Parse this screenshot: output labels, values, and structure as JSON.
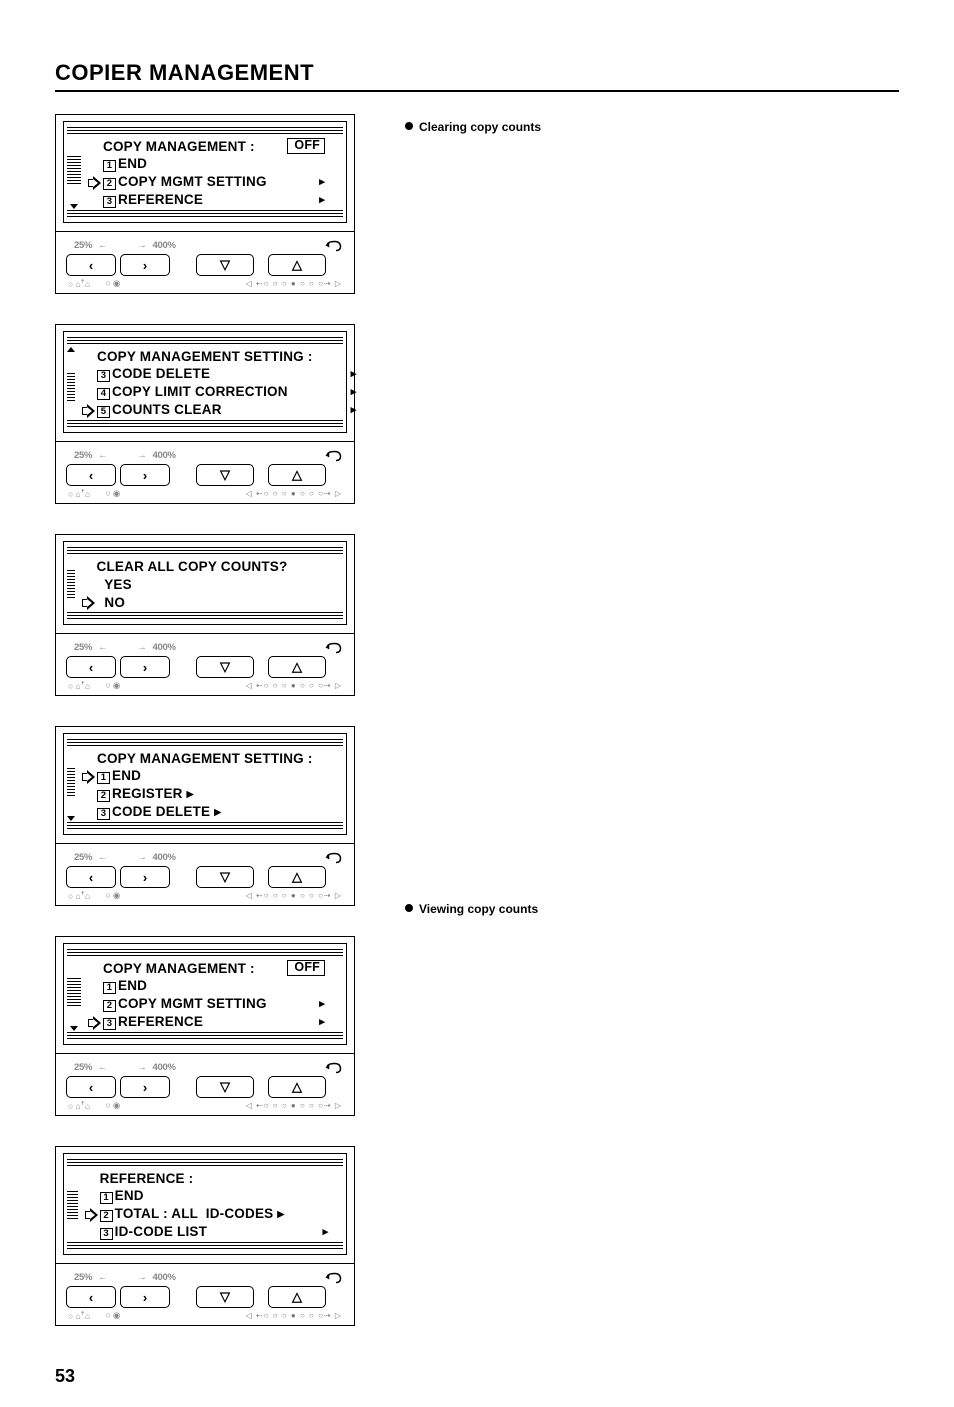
{
  "page": {
    "title": "COPIER MANAGEMENT",
    "number": "53"
  },
  "notes": {
    "clearing": "Clearing copy counts",
    "viewing": "Viewing copy counts"
  },
  "controls": {
    "zoom_left": "25%",
    "zoom_right": "400%",
    "btn_left": "‹",
    "btn_right": "›",
    "btn_down": "▽",
    "btn_up": "△",
    "foot_left": "○ ⌂ꜛ⌂",
    "foot_mid": "○ ◉",
    "foot_dots": "◁ ⇠○  ○  ○  ●  ○  ○  ○⇢ ▷"
  },
  "panels": [
    {
      "title": "COPY MANAGEMENT :",
      "status": "OFF",
      "selected": 1,
      "scroll_down": true,
      "items": [
        {
          "n": "1",
          "label": "END",
          "arrow": false
        },
        {
          "n": "2",
          "label": "COPY MGMT SETTING",
          "arrow": true
        },
        {
          "n": "3",
          "label": "REFERENCE",
          "arrow": true
        }
      ]
    },
    {
      "title": "COPY MANAGEMENT SETTING :",
      "selected": 2,
      "scroll_up": true,
      "items": [
        {
          "n": "3",
          "label": "CODE DELETE",
          "arrow": true
        },
        {
          "n": "4",
          "label": "COPY LIMIT CORRECTION",
          "arrow": true
        },
        {
          "n": "5",
          "label": "COUNTS CLEAR",
          "arrow": true
        }
      ]
    },
    {
      "title": "CLEAR ALL COPY COUNTS?",
      "selected": 1,
      "items": [
        {
          "label": "  YES"
        },
        {
          "label": "  NO"
        }
      ]
    },
    {
      "title": "COPY MANAGEMENT SETTING :",
      "selected": 0,
      "scroll_down": true,
      "items": [
        {
          "n": "1",
          "label": "END",
          "arrow": false
        },
        {
          "n": "2",
          "label": "REGISTER",
          "arrow": true,
          "tight": true
        },
        {
          "n": "3",
          "label": "CODE DELETE",
          "arrow": true,
          "tight": true
        }
      ]
    },
    {
      "title": "COPY MANAGEMENT :",
      "status": "OFF",
      "selected": 2,
      "scroll_down": true,
      "items": [
        {
          "n": "1",
          "label": "END",
          "arrow": false
        },
        {
          "n": "2",
          "label": "COPY MGMT SETTING",
          "arrow": true
        },
        {
          "n": "3",
          "label": "REFERENCE",
          "arrow": true
        }
      ]
    },
    {
      "title": "REFERENCE :",
      "selected": 1,
      "items": [
        {
          "n": "1",
          "label": "END",
          "arrow": false
        },
        {
          "n": "2",
          "label": "TOTAL : ALL  ID-CODES",
          "arrow": true,
          "tight": true
        },
        {
          "n": "3",
          "label": "ID-CODE LIST",
          "arrow": true
        }
      ]
    }
  ]
}
